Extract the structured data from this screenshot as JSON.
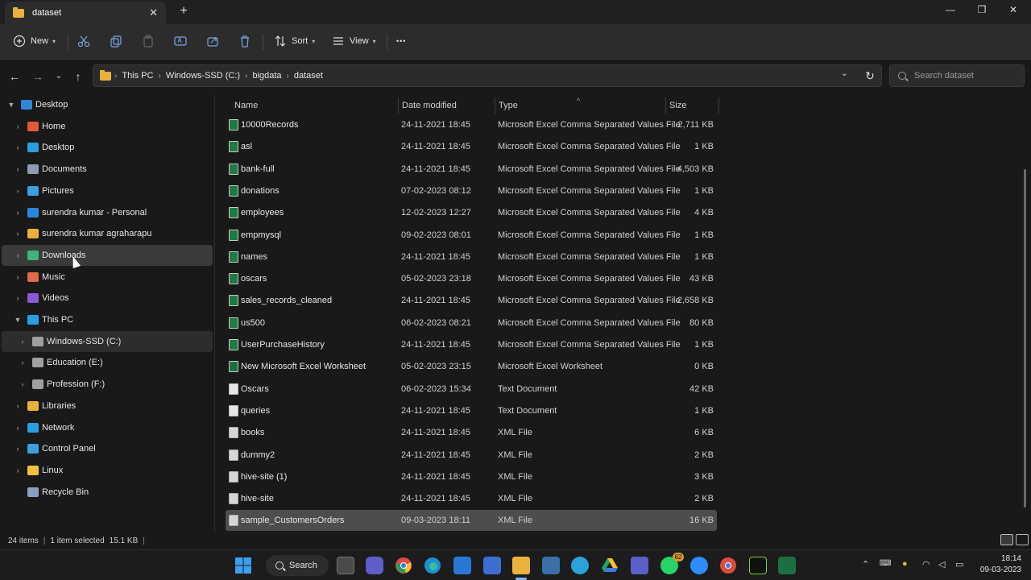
{
  "window": {
    "tab_title": "dataset",
    "new_tab": "+",
    "tab_close": "✕",
    "minimize": "—",
    "restore": "❐",
    "close": "✕"
  },
  "toolbar": {
    "new_label": "New",
    "sort_label": "Sort",
    "view_label": "View",
    "more_label": "•••",
    "icons": [
      "new-icon",
      "cut-icon",
      "copy-icon",
      "paste-icon",
      "rename-icon",
      "share-icon",
      "delete-icon",
      "sort-icon",
      "view-icon"
    ]
  },
  "address": {
    "breadcrumbs": [
      "This PC",
      "Windows-SSD (C:)",
      "bigdata",
      "dataset"
    ],
    "search_placeholder": "Search dataset"
  },
  "sidebar": {
    "items": [
      {
        "label": "Desktop",
        "arrow": "▼",
        "icon_color": "#2b88d8",
        "level": 0
      },
      {
        "label": "Home",
        "arrow": "›",
        "icon_color": "#e05a3a",
        "level": 1
      },
      {
        "label": "Desktop",
        "arrow": "›",
        "icon_color": "#2b9fe0",
        "level": 1
      },
      {
        "label": "Documents",
        "arrow": "›",
        "icon_color": "#8f9bb0",
        "level": 1
      },
      {
        "label": "Pictures",
        "arrow": "›",
        "icon_color": "#3aa0e0",
        "level": 1
      },
      {
        "label": "surendra kumar - Personal",
        "arrow": "›",
        "icon_color": "#2b88d8",
        "level": 1
      },
      {
        "label": "surendra kumar agraharapu",
        "arrow": "›",
        "icon_color": "#e8b23c",
        "level": 1
      },
      {
        "label": "Downloads",
        "arrow": "›",
        "icon_color": "#3fb37f",
        "level": 1
      },
      {
        "label": "Music",
        "arrow": "›",
        "icon_color": "#e06a4a",
        "level": 1
      },
      {
        "label": "Videos",
        "arrow": "›",
        "icon_color": "#8a5ad6",
        "level": 1
      },
      {
        "label": "This PC",
        "arrow": "▼",
        "icon_color": "#2b9fe0",
        "level": 1
      },
      {
        "label": "Windows-SSD (C:)",
        "arrow": "›",
        "icon_color": "#a0a0a0",
        "level": 2
      },
      {
        "label": "Education (E:)",
        "arrow": "›",
        "icon_color": "#a0a0a0",
        "level": 2
      },
      {
        "label": "Profession (F:)",
        "arrow": "›",
        "icon_color": "#a0a0a0",
        "level": 2
      },
      {
        "label": "Libraries",
        "arrow": "›",
        "icon_color": "#e8b23c",
        "level": 1
      },
      {
        "label": "Network",
        "arrow": "›",
        "icon_color": "#2b9fe0",
        "level": 1
      },
      {
        "label": "Control Panel",
        "arrow": "›",
        "icon_color": "#3aa0e0",
        "level": 1
      },
      {
        "label": "Linux",
        "arrow": "›",
        "icon_color": "#f0c040",
        "level": 1
      },
      {
        "label": "Recycle Bin",
        "arrow": "",
        "icon_color": "#8aa0c0",
        "level": 1
      }
    ]
  },
  "columns": {
    "name": "Name",
    "date": "Date modified",
    "type": "Type",
    "size": "Size",
    "sort_indicator": "^"
  },
  "files": [
    {
      "name": "10000Records",
      "date": "24-11-2021 18:45",
      "type": "Microsoft Excel Comma Separated Values File",
      "size": "2,711 KB",
      "kind": "csv"
    },
    {
      "name": "asl",
      "date": "24-11-2021 18:45",
      "type": "Microsoft Excel Comma Separated Values File",
      "size": "1 KB",
      "kind": "csv"
    },
    {
      "name": "bank-full",
      "date": "24-11-2021 18:45",
      "type": "Microsoft Excel Comma Separated Values File",
      "size": "4,503 KB",
      "kind": "csv"
    },
    {
      "name": "donations",
      "date": "07-02-2023 08:12",
      "type": "Microsoft Excel Comma Separated Values File",
      "size": "1 KB",
      "kind": "csv"
    },
    {
      "name": "employees",
      "date": "12-02-2023 12:27",
      "type": "Microsoft Excel Comma Separated Values File",
      "size": "4 KB",
      "kind": "csv"
    },
    {
      "name": "empmysql",
      "date": "09-02-2023 08:01",
      "type": "Microsoft Excel Comma Separated Values File",
      "size": "1 KB",
      "kind": "csv"
    },
    {
      "name": "names",
      "date": "24-11-2021 18:45",
      "type": "Microsoft Excel Comma Separated Values File",
      "size": "1 KB",
      "kind": "csv"
    },
    {
      "name": "oscars",
      "date": "05-02-2023 23:18",
      "type": "Microsoft Excel Comma Separated Values File",
      "size": "43 KB",
      "kind": "csv"
    },
    {
      "name": "sales_records_cleaned",
      "date": "24-11-2021 18:45",
      "type": "Microsoft Excel Comma Separated Values File",
      "size": "2,658 KB",
      "kind": "csv"
    },
    {
      "name": "us500",
      "date": "06-02-2023 08:21",
      "type": "Microsoft Excel Comma Separated Values File",
      "size": "80 KB",
      "kind": "csv"
    },
    {
      "name": "UserPurchaseHistory",
      "date": "24-11-2021 18:45",
      "type": "Microsoft Excel Comma Separated Values File",
      "size": "1 KB",
      "kind": "csv"
    },
    {
      "name": "New Microsoft Excel Worksheet",
      "date": "05-02-2023 23:15",
      "type": "Microsoft Excel Worksheet",
      "size": "0 KB",
      "kind": "xlsx"
    },
    {
      "name": "Oscars",
      "date": "06-02-2023 15:34",
      "type": "Text Document",
      "size": "42 KB",
      "kind": "txt"
    },
    {
      "name": "queries",
      "date": "24-11-2021 18:45",
      "type": "Text Document",
      "size": "1 KB",
      "kind": "txt"
    },
    {
      "name": "books",
      "date": "24-11-2021 18:45",
      "type": "XML File",
      "size": "6 KB",
      "kind": "xml"
    },
    {
      "name": "dummy2",
      "date": "24-11-2021 18:45",
      "type": "XML File",
      "size": "2 KB",
      "kind": "xml"
    },
    {
      "name": "hive-site (1)",
      "date": "24-11-2021 18:45",
      "type": "XML File",
      "size": "3 KB",
      "kind": "xml"
    },
    {
      "name": "hive-site",
      "date": "24-11-2021 18:45",
      "type": "XML File",
      "size": "2 KB",
      "kind": "xml"
    },
    {
      "name": "sample_CustomersOrders",
      "date": "09-03-2023 18:11",
      "type": "XML File",
      "size": "16 KB",
      "kind": "xml",
      "selected": true
    }
  ],
  "status": {
    "items_count": "24 items",
    "selection": "1 item selected",
    "selection_size": "15.1 KB"
  },
  "taskbar": {
    "search_label": "Search",
    "badge": "62",
    "time": "18:14",
    "date": "09-03-2023"
  }
}
